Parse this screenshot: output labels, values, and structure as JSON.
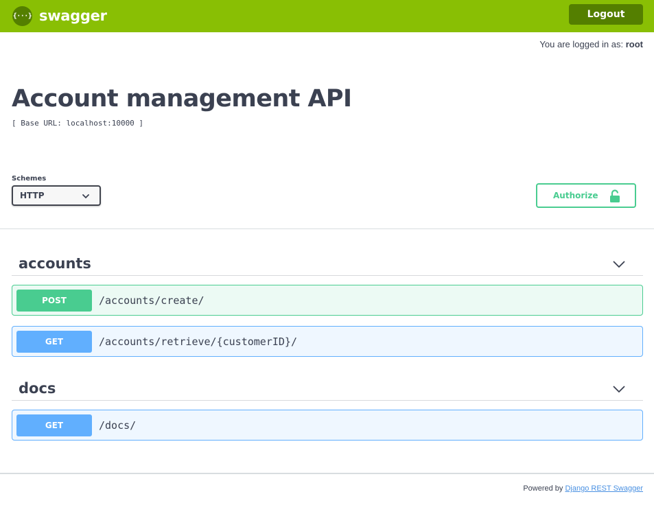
{
  "header": {
    "logo_glyph": "{···}",
    "brand": "swagger",
    "logout_label": "Logout",
    "accent_color": "#89bf04",
    "dark_accent_color": "#547f00"
  },
  "session": {
    "logged_in_prefix": "You are logged in as:",
    "username": "root"
  },
  "info": {
    "title": "Account management API",
    "base_url": "[ Base URL: localhost:10000 ]"
  },
  "schemes": {
    "label": "Schemes",
    "selected": "HTTP",
    "icon": "chevron-down-icon"
  },
  "authorize": {
    "label": "Authorize",
    "icon": "unlocked-lock-icon",
    "color": "#49cc90"
  },
  "tags": [
    {
      "name": "accounts",
      "operations": [
        {
          "method": "POST",
          "path": "/accounts/create/"
        },
        {
          "method": "GET",
          "path": "/accounts/retrieve/{customerID}/"
        }
      ]
    },
    {
      "name": "docs",
      "operations": [
        {
          "method": "GET",
          "path": "/docs/"
        }
      ]
    }
  ],
  "footer": {
    "prefix": "Powered by",
    "link_text": "Django REST Swagger"
  }
}
